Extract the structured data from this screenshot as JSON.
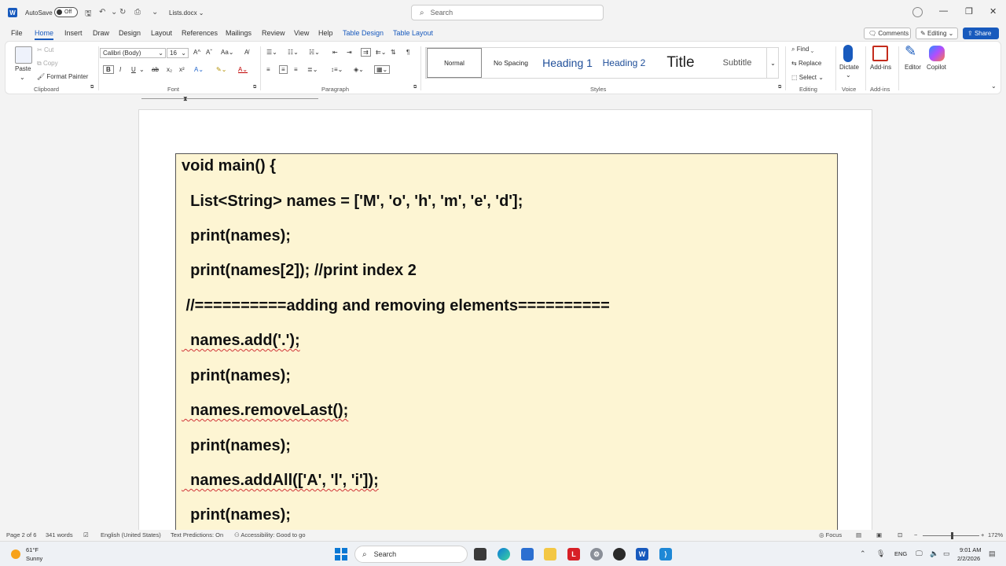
{
  "titlebar": {
    "autosave_label": "AutoSave",
    "autosave_state": "Off",
    "doc_name": "Lists.docx",
    "search_placeholder": "Search"
  },
  "menu": {
    "tabs": [
      "File",
      "Home",
      "Insert",
      "Draw",
      "Design",
      "Layout",
      "References",
      "Mailings",
      "Review",
      "View",
      "Help",
      "Table Design",
      "Table Layout"
    ],
    "active": "Home",
    "comments": "Comments",
    "editing": "Editing",
    "share": "Share"
  },
  "ribbon": {
    "clipboard": {
      "paste": "Paste",
      "cut": "Cut",
      "copy": "Copy",
      "format_painter": "Format Painter",
      "label": "Clipboard"
    },
    "font": {
      "name": "Calibri (Body)",
      "size": "16",
      "label": "Font"
    },
    "paragraph": {
      "label": "Paragraph"
    },
    "styles": {
      "items": [
        "Normal",
        "No Spacing",
        "Heading 1",
        "Heading 2",
        "Title",
        "Subtitle"
      ],
      "label": "Styles"
    },
    "editing": {
      "find": "Find",
      "replace": "Replace",
      "select": "Select",
      "label": "Editing"
    },
    "voice": {
      "dictate": "Dictate",
      "label": "Voice"
    },
    "addins": {
      "addins": "Add-ins",
      "label": "Add-ins"
    },
    "editor": "Editor",
    "copilot": "Copilot"
  },
  "document": {
    "code_lines": [
      "void main() {",
      "  List<String> names = ['M', 'o', 'h', 'm', 'e', 'd'];",
      "  print(names);",
      "  print(names[2]); //print index 2",
      " //==========adding and removing elements==========",
      "  names.add('.');",
      "  print(names);",
      "  names.removeLast();",
      "  print(names);",
      "  names.addAll(['A', 'l', 'i']);",
      "  print(names);"
    ]
  },
  "status": {
    "page": "Page 2 of 6",
    "words": "341 words",
    "language": "English (United States)",
    "predictions": "Text Predictions: On",
    "accessibility": "Accessibility: Good to go",
    "focus": "Focus",
    "zoom": "172%"
  },
  "taskbar": {
    "temp": "61°F",
    "weather": "Sunny",
    "search": "Search",
    "lang": "ENG",
    "time": "9:01 AM",
    "date": "2/2/2026"
  },
  "colors": {
    "accent": "#185abd",
    "code_bg": "#fdf5d3"
  }
}
